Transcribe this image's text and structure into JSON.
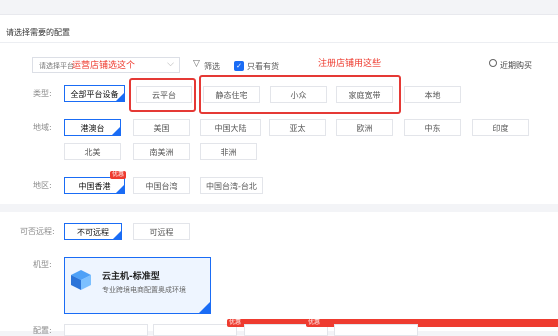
{
  "header": {
    "title": "请选择需要的配置"
  },
  "search": {
    "placeholder": "请选择平台"
  },
  "annotations": {
    "left": "运营店铺选这个",
    "right": "注册店铺用这些"
  },
  "filter": {
    "label": "筛选",
    "only_available_label": "只看有货",
    "only_available_checked": true,
    "recent_label": "近期购买"
  },
  "type_row": {
    "label": "类型:",
    "options": [
      "全部平台设备",
      "云平台",
      "静态住宅",
      "小众",
      "家庭宽带",
      "本地"
    ],
    "selected": "全部平台设备"
  },
  "region_row": {
    "label": "地域:",
    "options": [
      "港澳台",
      "美国",
      "中国大陆",
      "亚太",
      "欧洲",
      "中东",
      "印度",
      "北美",
      "南美洲",
      "非洲"
    ],
    "selected": "港澳台"
  },
  "area_row": {
    "label": "地区:",
    "options": [
      "中国香港",
      "中国台湾",
      "中国台湾-台北"
    ],
    "selected": "中国香港",
    "badge": "优惠"
  },
  "remote_row": {
    "label": "可否远程:",
    "options": [
      "不可远程",
      "可远程"
    ],
    "selected": "不可远程"
  },
  "model_row": {
    "label": "机型:",
    "card_title": "云主机-标准型",
    "card_desc": "专业跨境电商配置奥成环境"
  },
  "bottom_row": {
    "label": "配置:",
    "badges": [
      "优惠",
      "优惠"
    ]
  },
  "colors": {
    "accent": "#1a6cf5",
    "annotation": "#ee3b2f",
    "badge": "#ee3b2f"
  }
}
